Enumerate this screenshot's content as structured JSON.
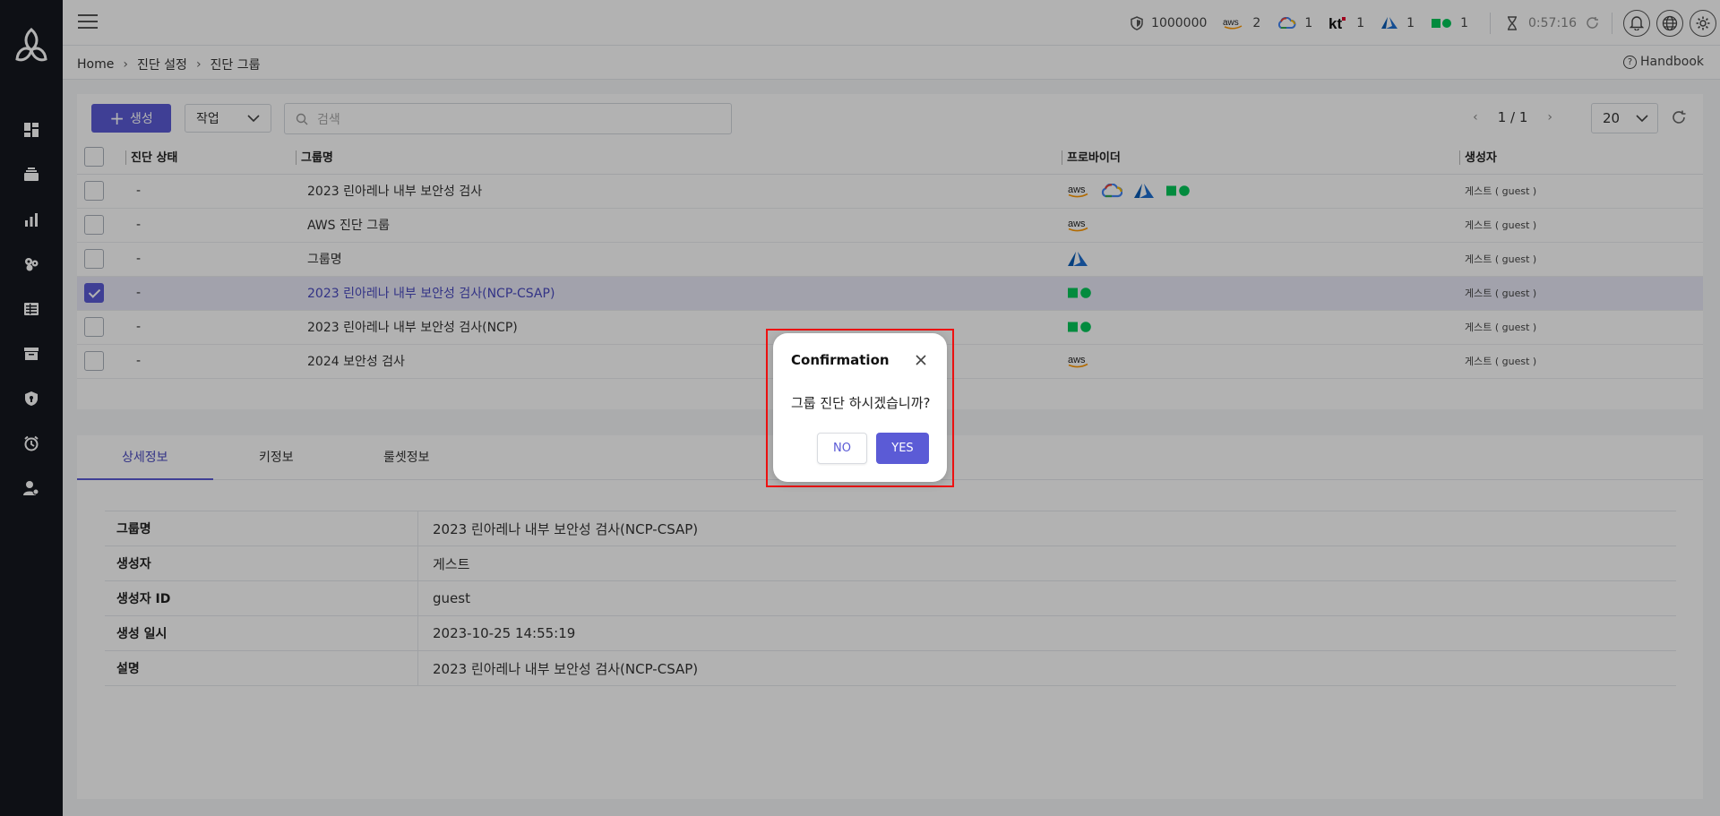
{
  "topbar": {
    "stats": [
      {
        "icon": "shield-icon",
        "value": "1000000"
      },
      {
        "icon": "aws-logo-icon",
        "value": "2"
      },
      {
        "icon": "gcp-cloud-icon",
        "value": "1"
      },
      {
        "icon": "kt-logo-icon",
        "value": "1"
      },
      {
        "icon": "azure-logo-icon",
        "value": "1"
      },
      {
        "icon": "ncp-logo-icon",
        "value": "1"
      }
    ],
    "timer": "0:57:16",
    "colors": {
      "aws": "#ff9900",
      "gcp_blue": "#4285f4",
      "gcp_red": "#ea4335",
      "gcp_yellow": "#fbbc04",
      "gcp_green": "#34a853",
      "kt_red": "#e4002b",
      "azure": "#0a5cb5",
      "ncp": "#03c75a"
    }
  },
  "breadcrumb": {
    "items": [
      "Home",
      "진단 설정",
      "진단 그룹"
    ]
  },
  "handbook": "Handbook",
  "toolbar": {
    "create_label": "생성",
    "job_select": "작업",
    "search_placeholder": "검색",
    "page_indicator": "1 / 1",
    "page_size": "20"
  },
  "table": {
    "headers": {
      "status": "진단 상태",
      "name": "그룹명",
      "provider": "프로바이더",
      "creator": "생성자"
    },
    "rows": [
      {
        "status": "-",
        "name": "2023 린아레나 내부 보안성 검사",
        "providers": [
          "aws",
          "gcp",
          "azure",
          "ncp"
        ],
        "creator": "게스트 ( guest )",
        "checked": false
      },
      {
        "status": "-",
        "name": "AWS 진단 그룹",
        "providers": [
          "aws"
        ],
        "creator": "게스트 ( guest )",
        "checked": false
      },
      {
        "status": "-",
        "name": "그룹명",
        "providers": [
          "azure"
        ],
        "creator": "게스트 ( guest )",
        "checked": false
      },
      {
        "status": "-",
        "name": "2023 린아레나 내부 보안성 검사(NCP-CSAP)",
        "providers": [
          "ncp"
        ],
        "creator": "게스트 ( guest )",
        "checked": true
      },
      {
        "status": "-",
        "name": "2023 린아레나 내부 보안성 검사(NCP)",
        "providers": [
          "ncp"
        ],
        "creator": "게스트 ( guest )",
        "checked": false
      },
      {
        "status": "-",
        "name": "2024 보안성 검사",
        "providers": [
          "aws"
        ],
        "creator": "게스트 ( guest )",
        "checked": false
      }
    ]
  },
  "detail": {
    "tabs": [
      "상세정보",
      "키정보",
      "룰셋정보"
    ],
    "rows": [
      {
        "key": "그룹명",
        "value": "2023 린아레나 내부 보안성 검사(NCP-CSAP)"
      },
      {
        "key": "생성자",
        "value": "게스트"
      },
      {
        "key": "생성자 ID",
        "value": "guest"
      },
      {
        "key": "생성 일시",
        "value": "2023-10-25 14:55:19"
      },
      {
        "key": "설명",
        "value": "2023 린아레나 내부 보안성 검사(NCP-CSAP)"
      }
    ]
  },
  "modal": {
    "title": "Confirmation",
    "message": "그룹 진단 하시겠습니까?",
    "no_label": "NO",
    "yes_label": "YES"
  }
}
